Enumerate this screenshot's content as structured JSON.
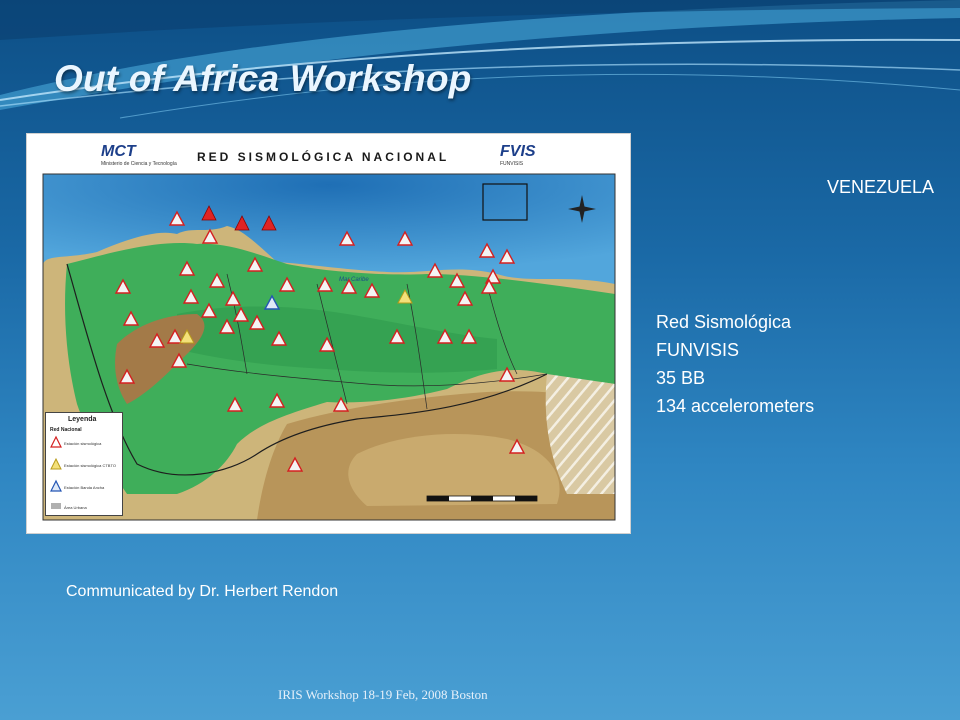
{
  "slide": {
    "title": "Out of Africa Workshop",
    "country": "VENEZUELA",
    "info_lines": [
      "Red Sismológica",
      "FUNVISIS",
      "35 BB",
      "134 accelerometers"
    ],
    "credit": "Communicated by Dr. Herbert Rendon",
    "footer": "IRIS Workshop 18-19 Feb, 2008   Boston"
  },
  "map": {
    "header": "RED SISMOLÓGICA NACIONAL",
    "logo_left": "MCT",
    "logo_left_sub": "Ministerio de Ciencia y Tecnología",
    "logo_right": "FVIS",
    "logo_right_sub": "FUNVISIS",
    "sea_label": "Mar Caribe",
    "legend_title": "Leyenda",
    "legend_subtitle": "Red Nacional",
    "legend_items": [
      "Estación sismológica",
      "Estación sismológica CTBTO",
      "Estación Banda Ancha",
      "Área Urbana"
    ]
  },
  "colors": {
    "background_top": "#0d4f86",
    "background_bottom": "#4a9fd3",
    "title_text": "#eaf6ff",
    "sea": "#2a86c6",
    "land_green": "#3fae5a",
    "station_red": "#e02424"
  }
}
